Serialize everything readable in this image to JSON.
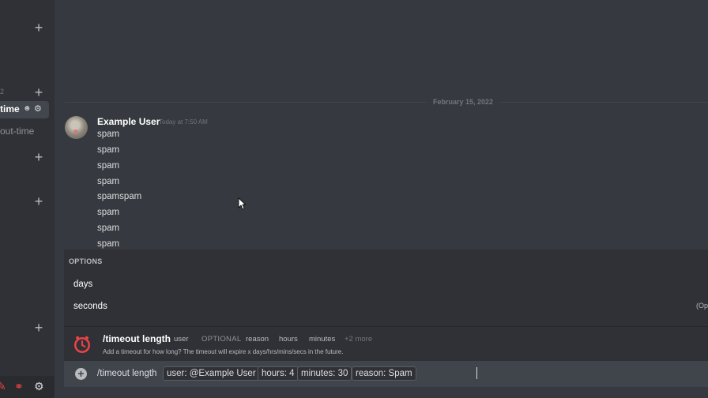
{
  "sidebar": {
    "active_channel_fragment": "time",
    "sub_channel_fragment": "out-time",
    "small_mark": "2"
  },
  "chat": {
    "date_divider": "February 15, 2022",
    "message": {
      "author": "Example User",
      "timestamp": "Today at 7:50 AM",
      "lines": [
        "spam",
        "spam",
        "spam",
        "spam",
        "spamspam",
        "spam",
        "spam",
        "spam"
      ]
    }
  },
  "options_popup": {
    "title": "OPTIONS",
    "items": [
      "days",
      "seconds"
    ],
    "right_fragment": "(Op"
  },
  "command_preview": {
    "name": "/timeout length",
    "chips": [
      "user",
      "OPTIONAL",
      "reason",
      "hours",
      "minutes",
      "+2 more"
    ],
    "description": "Add a timeout for how long? The timeout will expire x days/hrs/mins/secs in the future."
  },
  "input": {
    "command": "/timeout length",
    "args": [
      "user: @Example User",
      "hours: 4",
      "minutes: 30",
      "reason: Spam"
    ]
  },
  "colors": {
    "background": "#36393f",
    "sidebar": "#2f3136",
    "input": "#40444b",
    "command_icon": "#ed4245"
  },
  "icons": [
    "plus-icon",
    "user-icon",
    "gear-icon",
    "clock-icon",
    "add-circle-icon",
    "mic-icon",
    "headphones-icon",
    "cursor-icon"
  ]
}
